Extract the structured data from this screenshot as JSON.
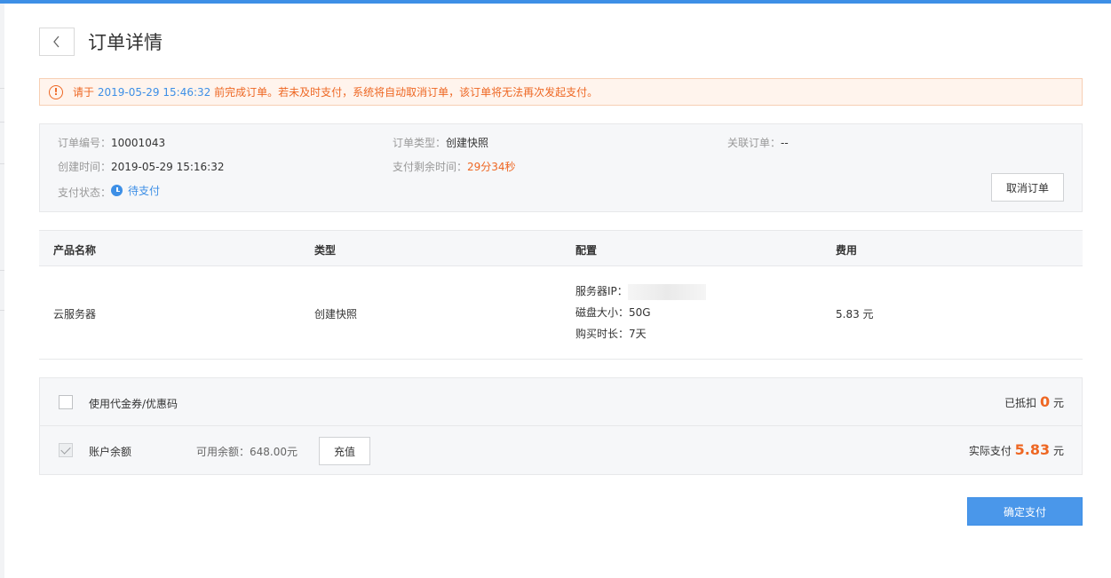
{
  "page": {
    "title": "订单详情"
  },
  "warning": {
    "prefix": "请于 ",
    "deadline": "2019-05-29 15:46:32",
    "suffix": " 前完成订单。若未及时支付，系统将自动取消订单，该订单将无法再次发起支付。"
  },
  "order_info": {
    "order_no_label": "订单编号：",
    "order_no": "10001043",
    "order_type_label": "订单类型：",
    "order_type": "创建快照",
    "related_label": "关联订单：",
    "related": "--",
    "created_label": "创建时间：",
    "created": "2019-05-29 15:16:32",
    "remaining_label": "支付剩余时间：",
    "remaining": "29分34秒",
    "status_label": "支付状态：",
    "status": "待支付",
    "cancel_label": "取消订单"
  },
  "table": {
    "headers": [
      "产品名称",
      "类型",
      "配置",
      "费用"
    ],
    "row": {
      "product": "云服务器",
      "type": "创建快照",
      "config": {
        "ip_label": "服务器IP：",
        "disk": "磁盘大小：50G",
        "duration": "购买时长：7天"
      },
      "fee": "5.83 元"
    }
  },
  "payment": {
    "coupon_label": "使用代金券/优惠码",
    "coupon_checked": false,
    "deducted_label": "已抵扣",
    "deducted_value": "0",
    "deducted_unit": "元",
    "balance_label": "账户余额",
    "balance_checked": true,
    "available": "可用余额：648.00元",
    "recharge_label": "充值",
    "actual_label": "实际支付",
    "actual_value": "5.83",
    "actual_unit": "元"
  },
  "confirm_label": "确定支付",
  "colors": {
    "accent": "#3d8fe6",
    "warning": "#ee6723"
  }
}
